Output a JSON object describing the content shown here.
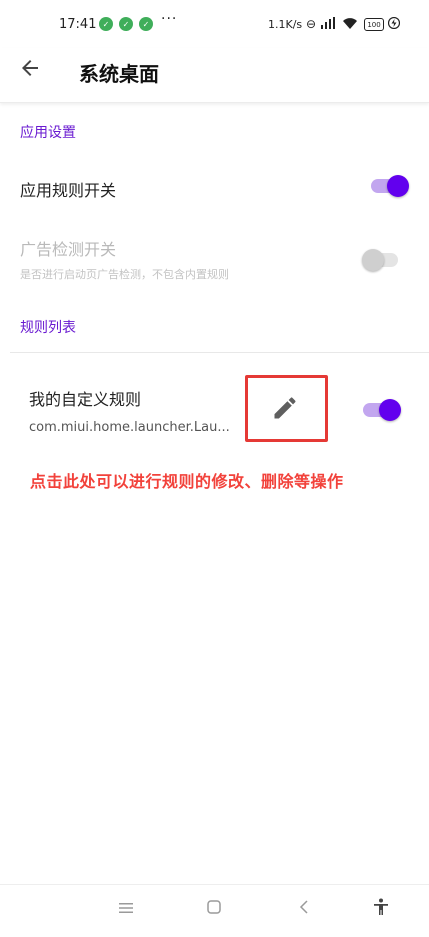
{
  "status_bar": {
    "time": "17:41",
    "notif_icons": [
      "app-notification-icon",
      "app-notification-icon",
      "app-notification-icon"
    ],
    "more": "···",
    "net_speed": "1.1K/s",
    "battery": "100"
  },
  "toolbar": {
    "title": "系统桌面"
  },
  "app_settings": {
    "section_title": "应用设置",
    "rule_switch_label": "应用规则开关",
    "rule_switch_on": true,
    "ad_detect_label": "广告检测开关",
    "ad_detect_desc": "是否进行启动页广告检测，不包含内置规则",
    "ad_detect_on": false
  },
  "rule_list": {
    "section_title": "规则列表",
    "rules": [
      {
        "name": "我的自定义规则",
        "package": "com.miui.home.launcher.Lau...",
        "enabled": true
      }
    ]
  },
  "annotation": {
    "text": "点击此处可以进行规则的修改、删除等操作"
  },
  "colors": {
    "accent": "#6200ee",
    "accent_track": "#c2a6ef",
    "annotation": "#f2423b",
    "highlight_box": "#e53935"
  }
}
